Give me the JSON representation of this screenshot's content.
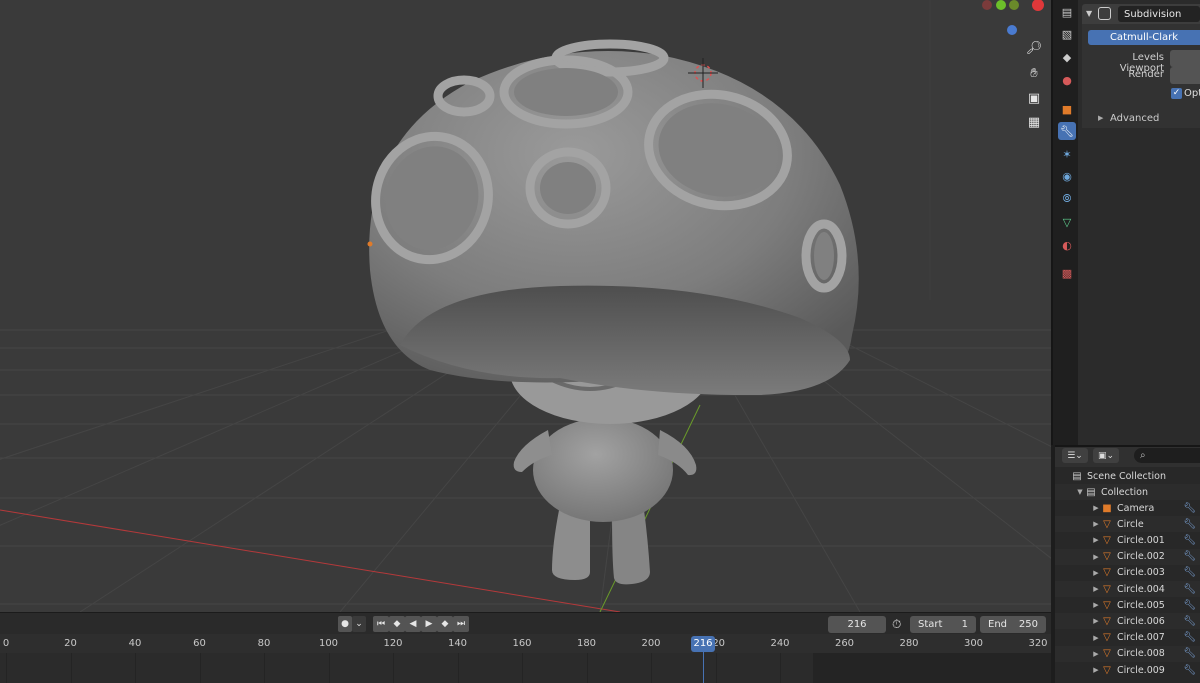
{
  "modifier": {
    "name": "Subdivision",
    "type_button": "Catmull-Clark",
    "levels_viewport_label": "Levels Viewport",
    "render_label": "Render",
    "optimal_label": "Opti",
    "advanced_label": "Advanced"
  },
  "timeline": {
    "current_frame": "216",
    "start_label": "Start",
    "start_value": "1",
    "end_label": "End",
    "end_value": "250",
    "ruler_labels": [
      "0",
      "20",
      "40",
      "60",
      "80",
      "100",
      "120",
      "140",
      "160",
      "180",
      "200",
      "216",
      "220",
      "240",
      "260",
      "280",
      "300",
      "320"
    ],
    "playhead_label": "216"
  },
  "outliner": {
    "scene_collection": "Scene Collection",
    "collection": "Collection",
    "items": [
      {
        "name": "Camera",
        "icon": "camera-icon"
      },
      {
        "name": "Circle",
        "icon": "mesh-icon"
      },
      {
        "name": "Circle.001",
        "icon": "mesh-icon"
      },
      {
        "name": "Circle.002",
        "icon": "mesh-icon"
      },
      {
        "name": "Circle.003",
        "icon": "mesh-icon"
      },
      {
        "name": "Circle.004",
        "icon": "mesh-icon"
      },
      {
        "name": "Circle.005",
        "icon": "mesh-icon"
      },
      {
        "name": "Circle.006",
        "icon": "mesh-icon"
      },
      {
        "name": "Circle.007",
        "icon": "mesh-icon"
      },
      {
        "name": "Circle.008",
        "icon": "mesh-icon"
      },
      {
        "name": "Circle.009",
        "icon": "mesh-icon"
      }
    ]
  },
  "colors": {
    "accent": "#4772b3",
    "x_axis": "#b5393a",
    "y_axis": "#6a9b2a",
    "object_orange": "#e07b2a"
  }
}
